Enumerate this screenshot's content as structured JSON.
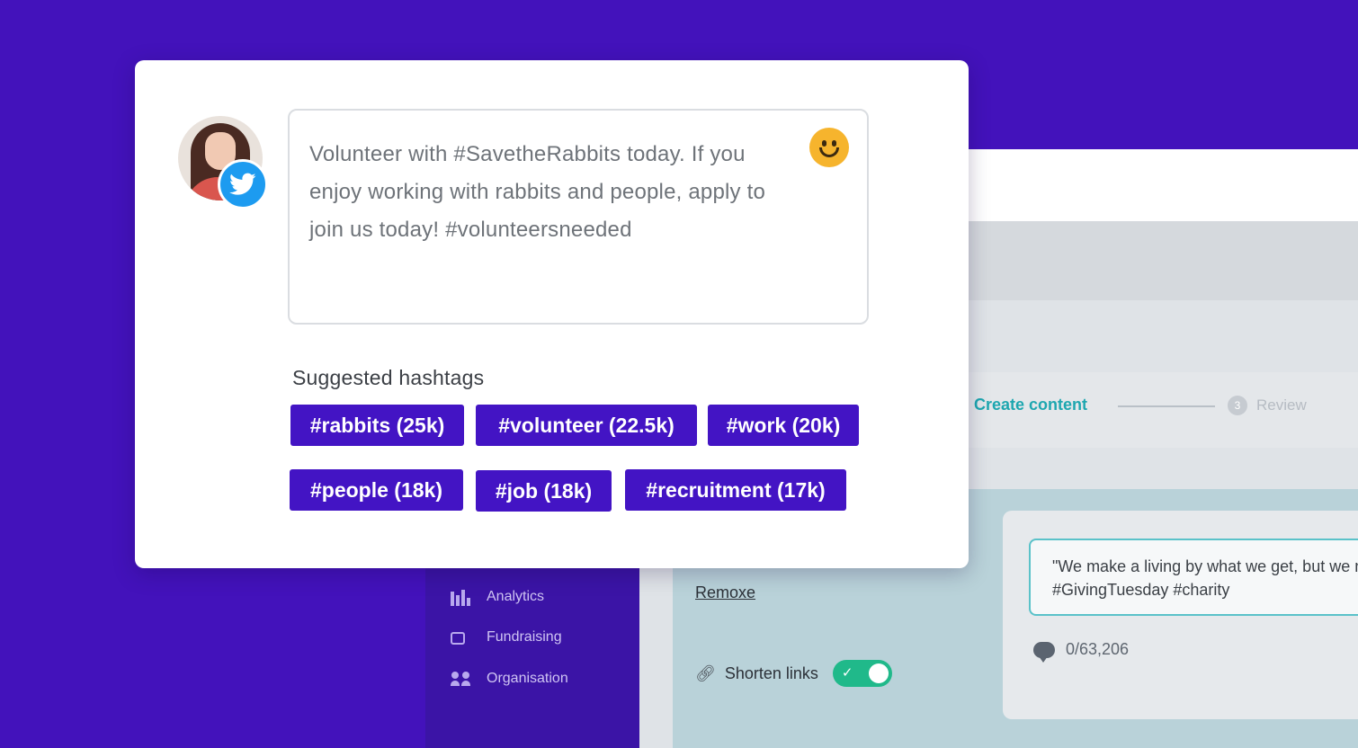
{
  "composer": {
    "text": "Volunteer with #SavetheRabbits today. If you enjoy working with rabbits and people, apply to join us today! #volunteersneeded",
    "avatar_icon": "user-avatar",
    "network_badge_icon": "twitter-icon",
    "emoji_icon": "smiley-icon"
  },
  "hashtags": {
    "title": "Suggested hashtags",
    "items": [
      {
        "label": "#rabbits (25k)"
      },
      {
        "label": "#volunteer (22.5k)"
      },
      {
        "label": "#work (20k)"
      },
      {
        "label": "#people (18k)"
      },
      {
        "label": "#job (18k)"
      },
      {
        "label": "#recruitment (17k)"
      }
    ]
  },
  "background_app": {
    "steps": [
      {
        "label": "Create content",
        "state": "active"
      },
      {
        "number": "3",
        "label": "Review",
        "state": "upcoming"
      }
    ],
    "nav": [
      {
        "label": "Analytics",
        "icon": "bar-chart-icon"
      },
      {
        "label": "Fundraising",
        "icon": "fundraising-icon"
      },
      {
        "label": "Organisation",
        "icon": "people-icon"
      }
    ],
    "remove_label": "Remoxe",
    "shorten_links": {
      "label": "Shorten links",
      "enabled": true
    },
    "post_text": "\"We make a living by what we get, but we make a life by what we give.\"\n#GivingTuesday #charity",
    "char_counter": "0/63,206"
  },
  "colors": {
    "page_background": "#4312bb",
    "chip_background": "#4314c4",
    "twitter_blue": "#1d9bf0",
    "toggle_on": "#20b98a",
    "step_active": "#1ea7b0"
  }
}
